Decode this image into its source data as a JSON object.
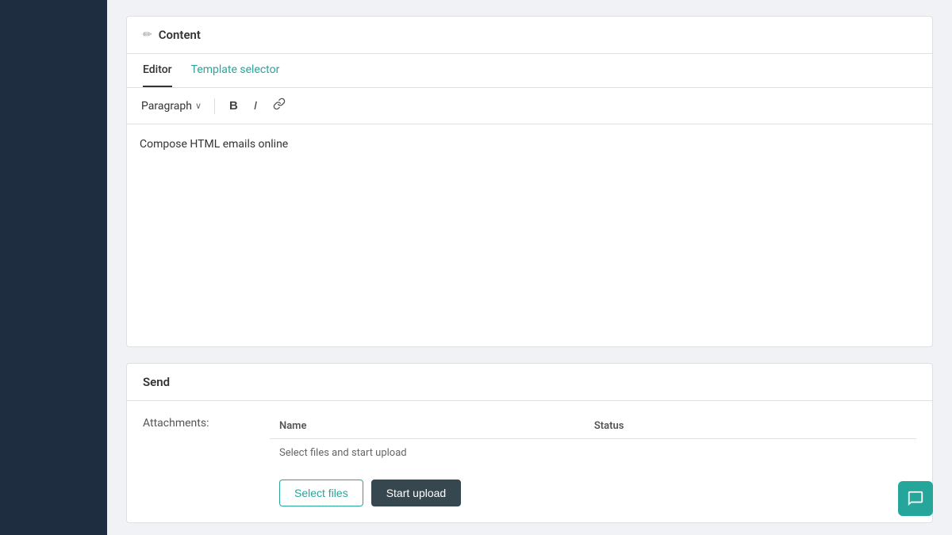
{
  "sidebar": {
    "background": "#1e2d40"
  },
  "content_card": {
    "header_icon": "✏",
    "title": "Content",
    "tabs": [
      {
        "id": "editor",
        "label": "Editor",
        "active": true
      },
      {
        "id": "template",
        "label": "Template selector",
        "active": false
      }
    ],
    "toolbar": {
      "paragraph_label": "Paragraph",
      "chevron": "∨",
      "bold": "B",
      "italic": "I",
      "link": "⌀"
    },
    "editor_content": "Compose HTML emails online"
  },
  "send_card": {
    "title": "Send",
    "attachments_label": "Attachments:",
    "table_headers": [
      "Name",
      "Status"
    ],
    "upload_hint": "Select files and start upload",
    "btn_select": "Select files",
    "btn_upload": "Start upload"
  },
  "chat_fab": {
    "icon": "💬"
  }
}
